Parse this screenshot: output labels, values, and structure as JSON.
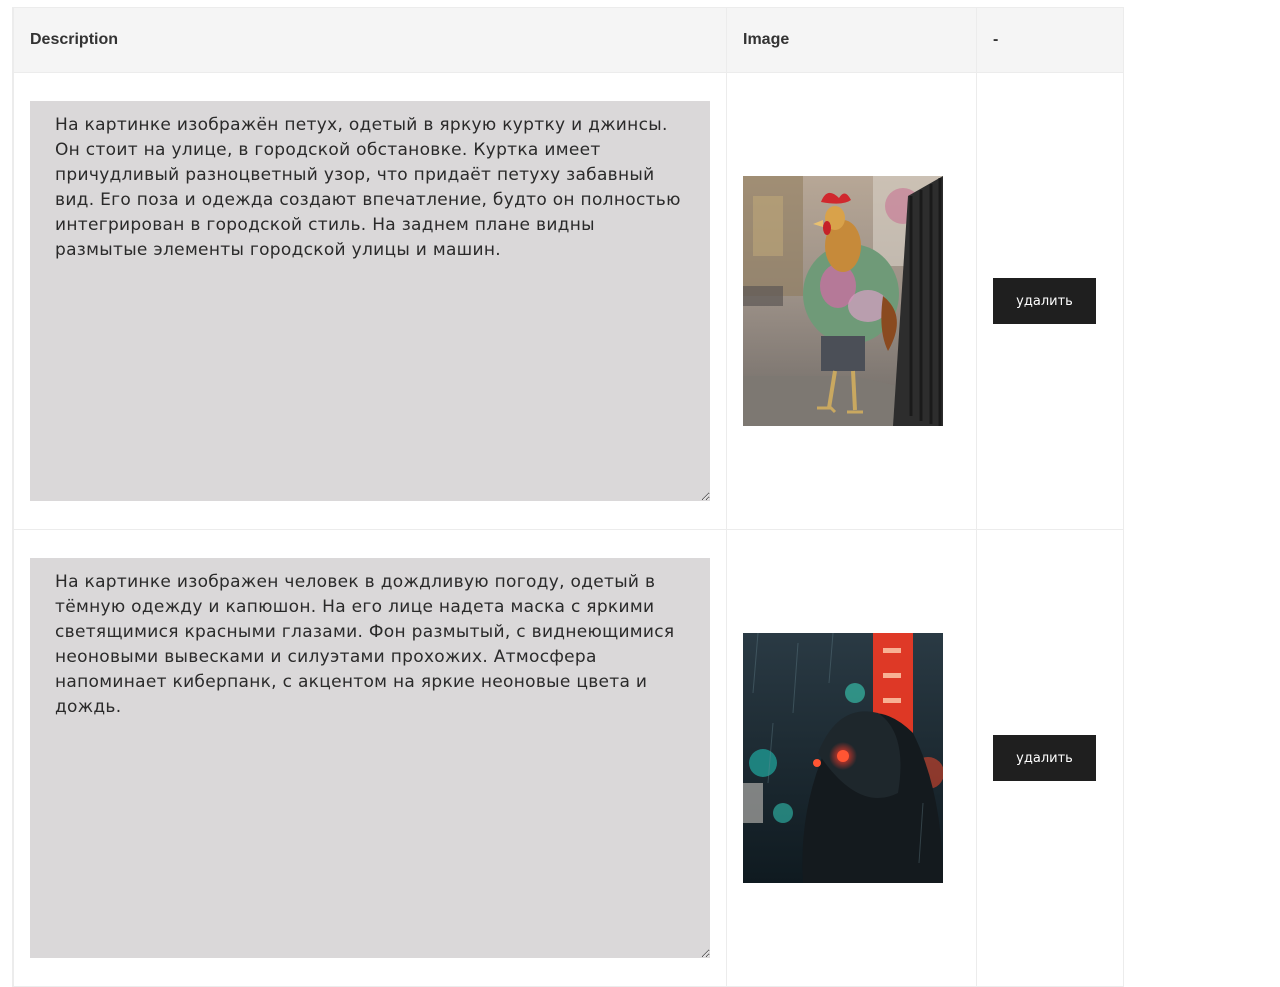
{
  "table": {
    "headers": [
      "Description",
      "Image",
      "-"
    ],
    "rows": [
      {
        "description": "На картинке изображён петух, одетый в яркую куртку и джинсы. Он стоит на улице, в городской обстановке. Куртка имеет причудливый разноцветный узор, что придаёт петуху забавный вид. Его поза и одежда создают впечатление, будто он полностью интегрирован в городской стиль. На заднем плане видны размытые элементы городской улицы и машин.",
        "delete_label": "удалить"
      },
      {
        "description": "На картинке изображен человек в дождливую погоду, одетый в тёмную одежду и капюшон. На его лице надета маска с яркими светящимися красными глазами. Фон размытый, с виднеющимися неоновыми вывесками и силуэтами прохожих. Атмосфера напоминает киберпанк, с акцентом на яркие неоновые цвета и дождь.",
        "delete_label": "удалить"
      }
    ]
  }
}
